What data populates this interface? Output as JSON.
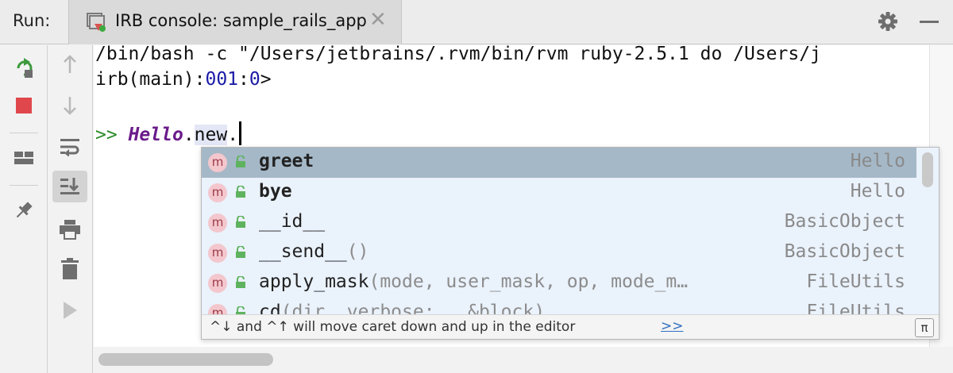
{
  "topbar": {
    "run_label": "Run:",
    "tab_title": "IRB console: sample_rails_app",
    "close_glyph": "✕",
    "tab_icon": "irb-console-icon",
    "settings_icon": "gear-icon",
    "hide_icon": "minimize-icon"
  },
  "left_toolbar": {
    "buttons": [
      "rerun-icon",
      "stop-icon",
      "layout-icon",
      "pin-icon"
    ]
  },
  "left_toolbar2": {
    "buttons": [
      "up-arrow-icon",
      "down-arrow-icon",
      "soft-wrap-icon",
      "scroll-to-end-icon",
      "print-icon",
      "trash-icon",
      "play-icon"
    ]
  },
  "console": {
    "command_line": "/bin/bash -c \"/Users/jetbrains/.rvm/bin/rvm ruby-2.5.1 do /Users/j",
    "irb_prefix": "irb(main):",
    "irb_line_num": "001",
    "irb_sep": ":",
    "irb_level": "0",
    "irb_suffix": ">",
    "input_prompt": ">>",
    "input_const": "Hello",
    "input_dot1": ".",
    "input_method": "new",
    "input_dot2": "."
  },
  "completion": {
    "items": [
      {
        "name": "greet",
        "params": "",
        "type": "Hello",
        "bold": true,
        "selected": true
      },
      {
        "name": "bye",
        "params": "",
        "type": "Hello",
        "bold": true,
        "selected": false
      },
      {
        "name": "__id__",
        "params": "",
        "type": "BasicObject",
        "bold": false,
        "selected": false
      },
      {
        "name": "__send__",
        "params": "()",
        "type": "BasicObject",
        "bold": false,
        "selected": false
      },
      {
        "name": "apply_mask",
        "params": "(mode, user_mask, op, mode_m…",
        "type": "FileUtils",
        "bold": false,
        "selected": false
      },
      {
        "name": "cd",
        "params": "(dir, verbose: , &block)",
        "type": "FileUtils",
        "bold": false,
        "selected": false
      }
    ],
    "badge_letter": "m",
    "footer_text": "^↓ and ^↑ will move caret down and up in the editor",
    "footer_link": ">>",
    "pi_label": "π"
  },
  "colors": {
    "selected_row": "#a5b8c7",
    "popup_bg": "#eaf2fc",
    "rerun_green": "#3d9a3d",
    "stop_red": "#e0474c"
  }
}
